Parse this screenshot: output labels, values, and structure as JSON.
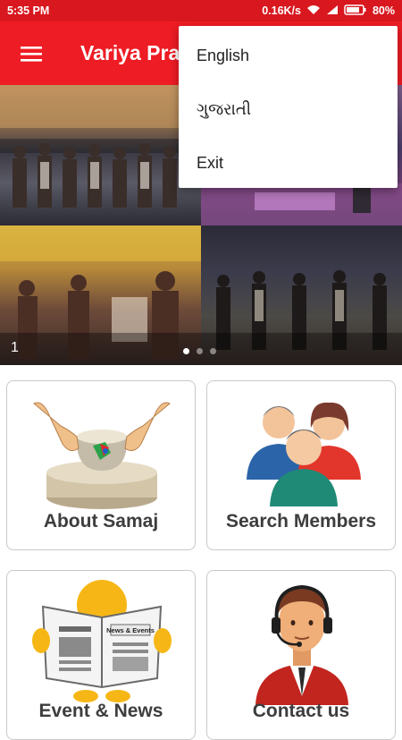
{
  "status_bar": {
    "time": "5:35 PM",
    "network_speed": "0.16K/s",
    "battery": "80%",
    "icons": [
      "wifi-icon",
      "signal-icon",
      "battery-icon"
    ]
  },
  "toolbar": {
    "title": "Variya Pra",
    "menu_icon": "hamburger-menu-icon",
    "background_color": "#ee1c24"
  },
  "banner": {
    "slide_number": "1",
    "total_dots": 3,
    "active_dot": 0
  },
  "dropdown_menu": {
    "items": [
      {
        "label": "English"
      },
      {
        "label": "ગુજરાતી"
      },
      {
        "label": "Exit"
      }
    ]
  },
  "cards": [
    {
      "label": "About Samaj",
      "icon": "pottery-hands-icon"
    },
    {
      "label": "Search Members",
      "icon": "people-group-icon"
    },
    {
      "label": "Event & News",
      "icon": "newspaper-reader-icon"
    },
    {
      "label": "Contact us",
      "icon": "support-agent-icon"
    }
  ]
}
